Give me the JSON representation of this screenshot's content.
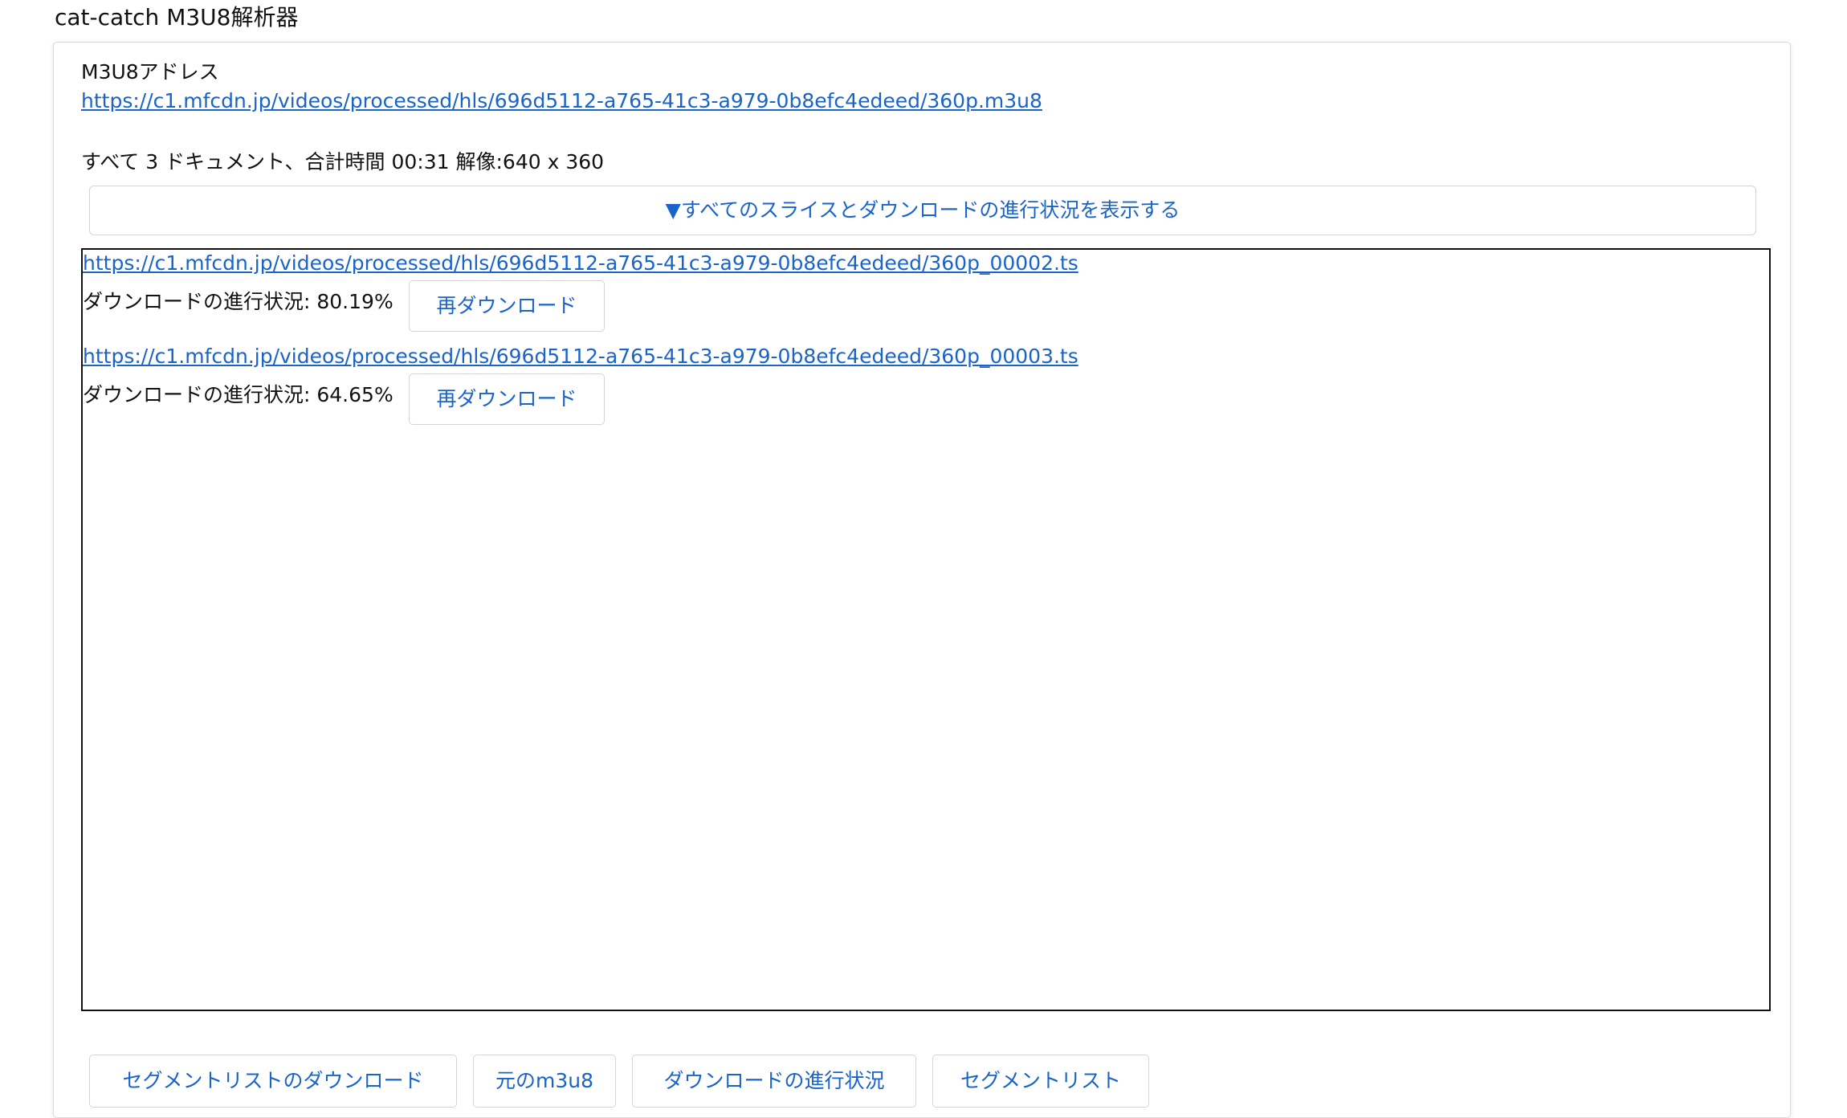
{
  "app_title": "cat-catch M3U8解析器",
  "m3u8": {
    "label": "M3U8アドレス",
    "url": "https://c1.mfcdn.jp/videos/processed/hls/696d5112-a765-41c3-a979-0b8efc4edeed/360p.m3u8"
  },
  "summary": "すべて 3 ドキュメント、合計時間 00:31 解像:640 x 360",
  "toggle_label": "▼すべてのスライスとダウンロードの進行状況を表示する",
  "segments": [
    {
      "url": "https://c1.mfcdn.jp/videos/processed/hls/696d5112-a765-41c3-a979-0b8efc4edeed/360p_00002.ts",
      "progress_text": "ダウンロードの進行状況: 80.19%",
      "redownload_label": "再ダウンロード"
    },
    {
      "url": "https://c1.mfcdn.jp/videos/processed/hls/696d5112-a765-41c3-a979-0b8efc4edeed/360p_00003.ts",
      "progress_text": "ダウンロードの進行状況: 64.65%",
      "redownload_label": "再ダウンロード"
    }
  ],
  "bottom_buttons": {
    "download_segment_list": "セグメントリストのダウンロード",
    "original_m3u8": "元のm3u8",
    "download_progress": "ダウンロードの進行状況",
    "segment_list": "セグメントリスト"
  },
  "colors": {
    "link": "#1a63c9",
    "border": "#d4d4d4",
    "text": "#111111"
  }
}
